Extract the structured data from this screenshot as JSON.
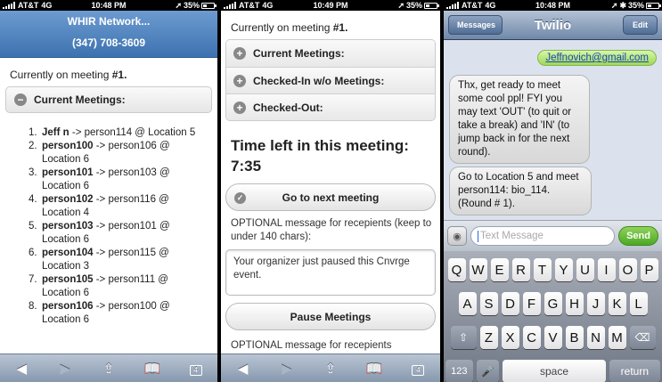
{
  "panel1": {
    "status": {
      "carrier": "AT&T",
      "network": "4G",
      "time": "10:48 PM",
      "battery": "35%"
    },
    "header_title": "WHIR Network...",
    "header_phone": "(347) 708-3609",
    "meeting_prefix": "Currently on meeting ",
    "meeting_number": "#1.",
    "current_meetings_label": "Current Meetings:",
    "meetings": [
      {
        "num": "1.",
        "name": "Jeff n",
        "arrow": " -> ",
        "rest": "person114 @ Location 5"
      },
      {
        "num": "2.",
        "name": "person100",
        "arrow": " -> ",
        "rest": "person106 @ Location 6"
      },
      {
        "num": "3.",
        "name": "person101",
        "arrow": " -> ",
        "rest": "person103 @ Location 6"
      },
      {
        "num": "4.",
        "name": "person102",
        "arrow": " -> ",
        "rest": "person116 @ Location 4"
      },
      {
        "num": "5.",
        "name": "person103",
        "arrow": " -> ",
        "rest": "person101 @ Location 6"
      },
      {
        "num": "6.",
        "name": "person104",
        "arrow": " -> ",
        "rest": "person115 @ Location 3"
      },
      {
        "num": "7.",
        "name": "person105",
        "arrow": " -> ",
        "rest": "person111 @ Location 6"
      },
      {
        "num": "8.",
        "name": "person106",
        "arrow": " -> ",
        "rest": "person100 @ Location 6"
      }
    ],
    "tab_count": "4"
  },
  "panel2": {
    "status": {
      "carrier": "AT&T",
      "network": "4G",
      "time": "10:49 PM",
      "battery": "35%"
    },
    "meeting_prefix": "Currently on meeting ",
    "meeting_number": "#1.",
    "accordion": [
      "Current Meetings:",
      "Checked-In w/o Meetings:",
      "Checked-Out:"
    ],
    "time_left_label": "Time left in this meeting:",
    "time_left_value": "7:35",
    "next_button": "Go to next meeting",
    "optional_label": "OPTIONAL message for recepients (keep to under 140 chars):",
    "message_text": "Your organizer just paused this Cnvrge event.",
    "pause_button": "Pause Meetings",
    "optional_label_2": "OPTIONAL message for recepients",
    "tab_count": "4"
  },
  "panel3": {
    "status": {
      "carrier": "AT&T",
      "network": "4G",
      "time": "10:48 PM",
      "battery": "35%"
    },
    "back_label": "Messages",
    "title": "Twilio",
    "edit_label": "Edit",
    "sent_bubble": "Jeffnovich@gmail.com",
    "received_1": "Thx, get ready to meet some cool ppl! FYI you may text 'OUT' (to quit or take a break) and 'IN' (to jump back in for the next round).",
    "received_2": "Go to Location 5 and meet person114: bio_114. (Round # 1).",
    "input_placeholder": "Text Message",
    "send_label": "Send",
    "keyboard": {
      "row1": [
        "Q",
        "W",
        "E",
        "R",
        "T",
        "Y",
        "U",
        "I",
        "O",
        "P"
      ],
      "row2": [
        "A",
        "S",
        "D",
        "F",
        "G",
        "H",
        "J",
        "K",
        "L"
      ],
      "row3": [
        "Z",
        "X",
        "C",
        "V",
        "B",
        "N",
        "M"
      ],
      "k123": "123",
      "space": "space",
      "return": "return"
    }
  },
  "colors": {
    "header_blue": "#3d72b0",
    "sent_bubble_green": "#9fd75a",
    "send_button_green": "#4ca823",
    "nav_blue": "#6f88a9"
  }
}
